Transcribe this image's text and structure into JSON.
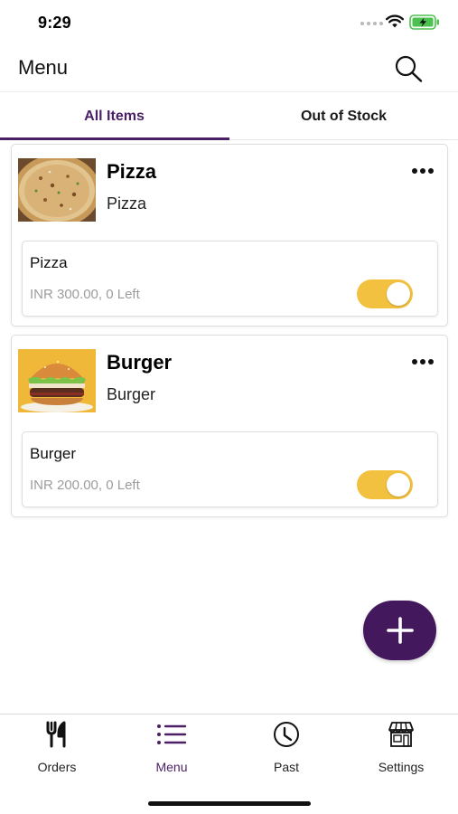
{
  "status_bar": {
    "time": "9:29"
  },
  "header": {
    "title": "Menu",
    "search_icon": "search-icon"
  },
  "tabs": [
    {
      "label": "All Items",
      "active": true
    },
    {
      "label": "Out of Stock",
      "active": false
    }
  ],
  "items": [
    {
      "name": "Pizza",
      "category": "Pizza",
      "image": "pizza-image",
      "variant": {
        "name": "Pizza",
        "price_text": "INR 300.00, 0 Left",
        "in_stock": true
      }
    },
    {
      "name": "Burger",
      "category": "Burger",
      "image": "burger-image",
      "variant": {
        "name": "Burger",
        "price_text": "INR 200.00, 0 Left",
        "in_stock": true
      }
    }
  ],
  "fab": {
    "icon": "plus-icon"
  },
  "bottom_nav": [
    {
      "label": "Orders",
      "icon": "fork-knife-icon",
      "active": false
    },
    {
      "label": "Menu",
      "icon": "list-icon",
      "active": true
    },
    {
      "label": "Past",
      "icon": "clock-icon",
      "active": false
    },
    {
      "label": "Settings",
      "icon": "store-icon",
      "active": false
    }
  ],
  "colors": {
    "brand": "#4a1f63",
    "fab": "#44185c",
    "toggle_on": "#f2c13f",
    "muted_text": "#9c9c9c"
  }
}
